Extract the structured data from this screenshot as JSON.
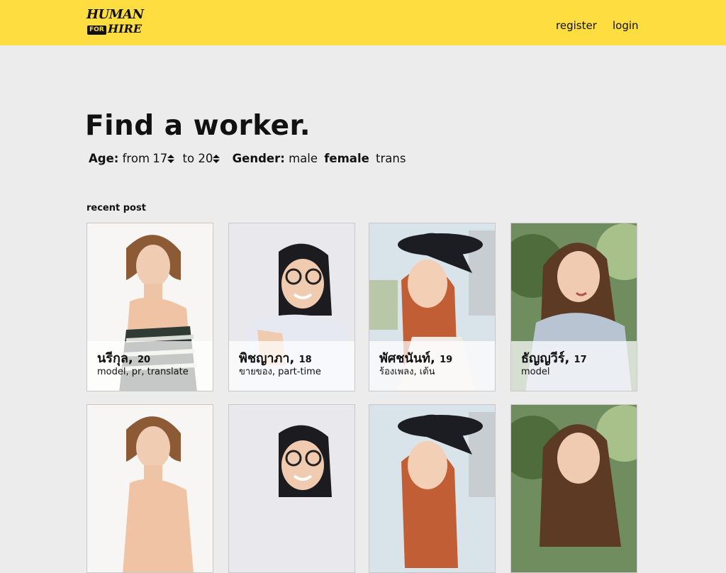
{
  "header": {
    "logo_top": "HUMAN",
    "logo_for": "FOR",
    "logo_bottom": "HIRE",
    "register": "register",
    "login": "login"
  },
  "title": "Find a worker.",
  "filters": {
    "age_label": "Age:",
    "from_label": "from",
    "from_value": "17",
    "to_label": "to",
    "to_value": "20",
    "gender_label": "Gender:",
    "gender_options": [
      "male",
      "female",
      "trans"
    ],
    "gender_selected": "female"
  },
  "section_label": "recent post",
  "colors": {
    "header_bg": "#fddd40",
    "page_bg": "#ececec"
  },
  "workers": [
    {
      "name": "นรีกุล",
      "age": "20",
      "tags": "model, pr, translate"
    },
    {
      "name": "พิชญาภา",
      "age": "18",
      "tags": "ขายของ, part-time"
    },
    {
      "name": "พัศชนันท์",
      "age": "19",
      "tags": "ร้องเพลง, เต้น"
    },
    {
      "name": "ธัญญวีร์",
      "age": "17",
      "tags": "model"
    }
  ]
}
